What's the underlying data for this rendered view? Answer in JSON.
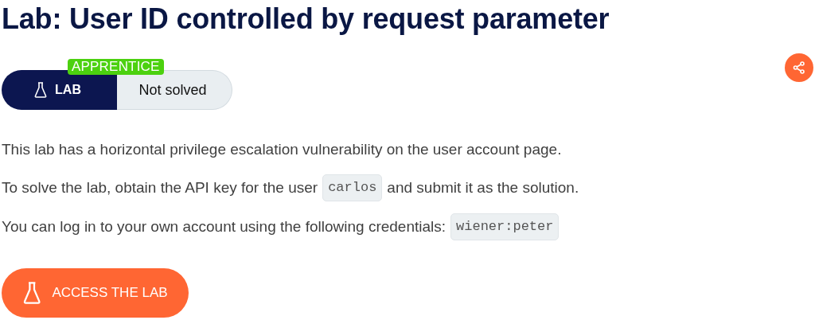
{
  "title": "Lab: User ID controlled by request parameter",
  "level_tag": "APPRENTICE",
  "lab_label": "LAB",
  "status": {
    "label": "Not solved",
    "solved": false
  },
  "paragraphs": [
    [
      {
        "kind": "text",
        "text": "This lab has a horizontal privilege escalation vulnerability on the user account page."
      }
    ],
    [
      {
        "kind": "text",
        "text": "To solve the lab, obtain the API key for the user"
      },
      {
        "kind": "code",
        "text": "carlos"
      },
      {
        "kind": "text",
        "text": "and submit it as the solution."
      }
    ],
    [
      {
        "kind": "text",
        "text": "You can log in to your own account using the following credentials:"
      },
      {
        "kind": "code",
        "text": "wiener:peter"
      }
    ]
  ],
  "access_button": "ACCESS THE LAB"
}
